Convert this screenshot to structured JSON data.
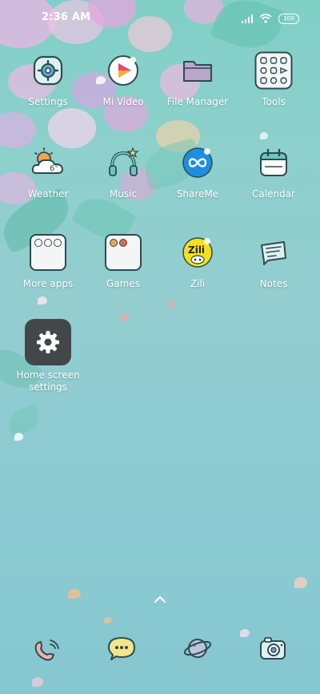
{
  "status_bar": {
    "time": "2:36 AM",
    "battery_level": "100",
    "icons": [
      "signal-icon",
      "wifi-icon",
      "battery-icon"
    ]
  },
  "apps": [
    {
      "label": "Settings",
      "icon": "settings-gear-icon"
    },
    {
      "label": "Mi Video",
      "icon": "play-icon"
    },
    {
      "label": "File Manager",
      "icon": "folder-icon"
    },
    {
      "label": "Tools",
      "icon": "tools-folder-icon"
    },
    {
      "label": "Weather",
      "icon": "sun-cloud-icon"
    },
    {
      "label": "Music",
      "icon": "headphones-icon"
    },
    {
      "label": "ShareMe",
      "icon": "infinity-icon"
    },
    {
      "label": "Calendar",
      "icon": "calendar-icon"
    },
    {
      "label": "More apps",
      "icon": "apps-folder-icon"
    },
    {
      "label": "Games",
      "icon": "games-folder-icon"
    },
    {
      "label": "Zili",
      "icon": "zili-icon"
    },
    {
      "label": "Notes",
      "icon": "notes-icon"
    }
  ],
  "home_screen_settings": {
    "line1": "Home screen",
    "line2": "settings"
  },
  "zili_logo_text": "Zili",
  "weather_temp": "6°",
  "dock": [
    {
      "icon": "phone-icon"
    },
    {
      "icon": "messages-icon"
    },
    {
      "icon": "browser-planet-icon"
    },
    {
      "icon": "camera-icon"
    }
  ],
  "colors": {
    "outline": "#2f4a52",
    "accent_blue": "#1e8fe0",
    "zili_yellow": "#f5e11a"
  }
}
